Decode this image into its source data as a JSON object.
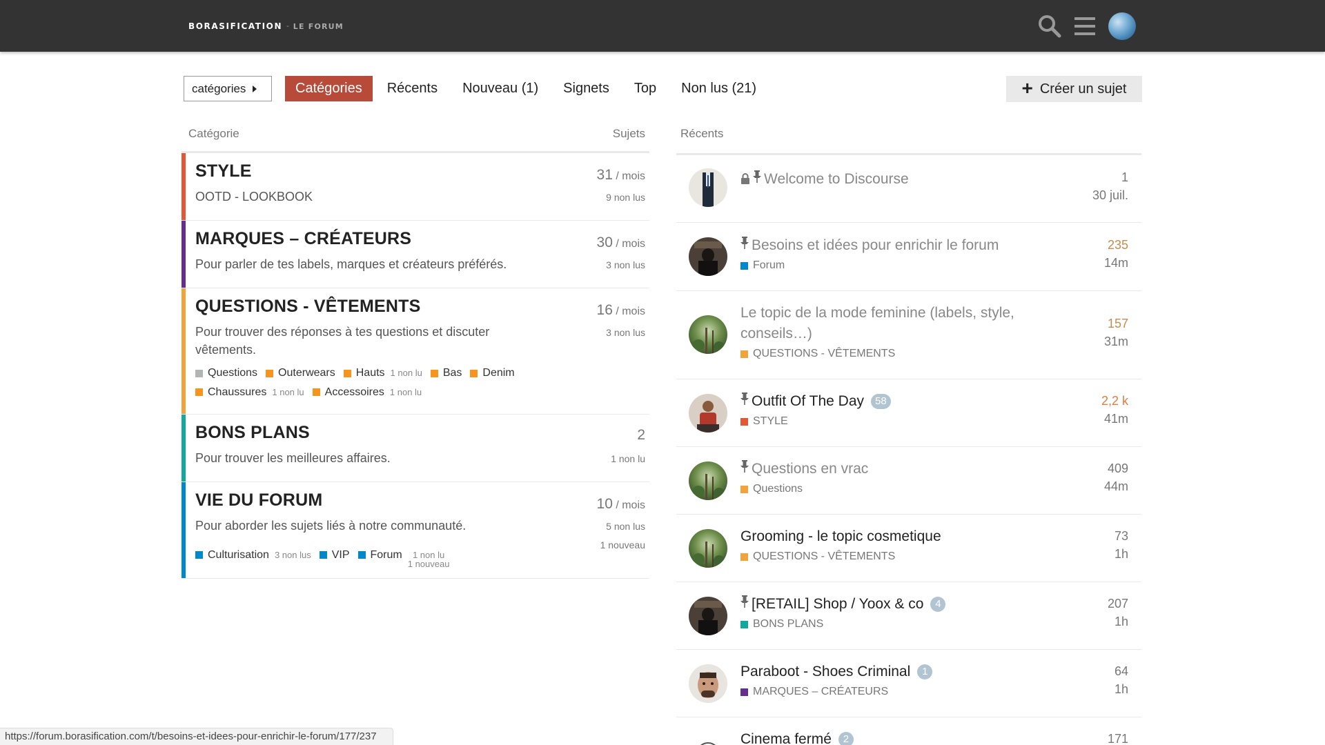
{
  "header": {
    "brand": "BORASIFICATION",
    "separator": "-",
    "sub": "LE FORUM"
  },
  "nav": {
    "dropdown_label": "catégories",
    "pills": [
      "Catégories",
      "Récents",
      "Nouveau (1)",
      "Signets",
      "Top",
      "Non lus (21)"
    ],
    "active_pill": "Catégories",
    "create_label": "Créer un sujet"
  },
  "categories_table": {
    "col_category": "Catégorie",
    "col_topics": "Sujets",
    "rows": [
      {
        "name": "STYLE",
        "color": "#e45735",
        "description": "OOTD - LOOKBOOK",
        "count": "31",
        "per": " / mois",
        "unread": "9 non lus"
      },
      {
        "name": "MARQUES – CRÉATEURS",
        "color": "#652d90",
        "description": "Pour parler de tes labels, marques et créateurs préférés.",
        "count": "30",
        "per": " / mois",
        "unread": "3 non lus"
      },
      {
        "name": "QUESTIONS - VÊTEMENTS",
        "color": "#f1a33c",
        "description": "Pour trouver des réponses à tes questions et discuter vêtements.",
        "count": "16",
        "per": " / mois",
        "unread": "3 non lus",
        "subcategories": [
          {
            "name": "Questions",
            "color": "#b3b5b4",
            "unread": ""
          },
          {
            "name": "Outerwears",
            "color": "#f7941d",
            "unread": ""
          },
          {
            "name": "Hauts",
            "color": "#f7941d",
            "unread": "1 non lu"
          },
          {
            "name": "Bas",
            "color": "#f7941d",
            "unread": ""
          },
          {
            "name": "Denim",
            "color": "#f7941d",
            "unread": ""
          },
          {
            "name": "Chaussures",
            "color": "#f7941d",
            "unread": "1 non lu"
          },
          {
            "name": "Accessoires",
            "color": "#f7941d",
            "unread": "1 non lu"
          }
        ]
      },
      {
        "name": "BONS PLANS",
        "color": "#12a89d",
        "description": "Pour trouver les meilleures affaires.",
        "count": "2",
        "per": "",
        "unread": "1 non lu"
      },
      {
        "name": "VIE DU FORUM",
        "color": "#0088cc",
        "description": "Pour aborder les sujets liés à notre communauté.",
        "count": "10",
        "per": " / mois",
        "unread": "5 non lus",
        "new": "1 nouveau",
        "subcategories": [
          {
            "name": "Culturisation",
            "color": "#0088cc",
            "unread": "3 non lus"
          },
          {
            "name": "VIP",
            "color": "#0088cc",
            "unread": ""
          },
          {
            "name": "Forum",
            "color": "#0088cc",
            "unread": "1 non lu",
            "new": "1 nouveau"
          }
        ]
      }
    ]
  },
  "topics": {
    "col_recent": "Récents",
    "items": [
      {
        "title": "Welcome to Discourse",
        "locked": true,
        "pinned": true,
        "read": true,
        "badge": "",
        "category": "",
        "category_color": "",
        "posts": "1",
        "age": "30 juil.",
        "avatar": "suit"
      },
      {
        "title": "Besoins et idées pour enrichir le forum",
        "pinned": true,
        "read": true,
        "badge": "",
        "category": "Forum",
        "category_color": "#0088cc",
        "posts": "235",
        "age": "14m",
        "avatar": "dark"
      },
      {
        "title": "Le topic de la mode feminine (labels, style, conseils…)",
        "read": true,
        "badge": "",
        "category": "QUESTIONS - VÊTEMENTS",
        "category_color": "#f1a33c",
        "posts": "157",
        "age": "31m",
        "avatar": "forest"
      },
      {
        "title": "Outfit Of The Day",
        "pinned": true,
        "read": false,
        "badge": "58",
        "category": "STYLE",
        "category_color": "#e45735",
        "posts": "2,2 k",
        "age": "41m",
        "avatar": "person"
      },
      {
        "title": "Questions en vrac",
        "pinned": true,
        "read": true,
        "badge": "",
        "category": "Questions",
        "category_color": "#f1a33c",
        "posts": "409",
        "age": "44m",
        "avatar": "forest"
      },
      {
        "title": "Grooming - le topic cosmetique",
        "read": false,
        "badge": "",
        "category": "QUESTIONS - VÊTEMENTS",
        "category_color": "#f1a33c",
        "posts": "73",
        "age": "1h",
        "avatar": "forest"
      },
      {
        "title": "[RETAIL] Shop / Yoox & co",
        "pinned": true,
        "read": false,
        "badge": "4",
        "category": "BONS PLANS",
        "category_color": "#12a89d",
        "posts": "207",
        "age": "1h",
        "avatar": "dark"
      },
      {
        "title": "Paraboot - Shoes Criminal",
        "read": false,
        "badge": "1",
        "category": "MARQUES – CRÉATEURS",
        "category_color": "#652d90",
        "posts": "64",
        "age": "1h",
        "avatar": "face"
      },
      {
        "title": "Cinema fermé",
        "read": false,
        "badge": "2",
        "category": "",
        "category_color": "",
        "posts": "171",
        "age": "",
        "avatar": "sketch"
      }
    ]
  },
  "status_url": "https://forum.borasification.com/t/besoins-et-idees-pour-enrichir-le-forum/177/237"
}
